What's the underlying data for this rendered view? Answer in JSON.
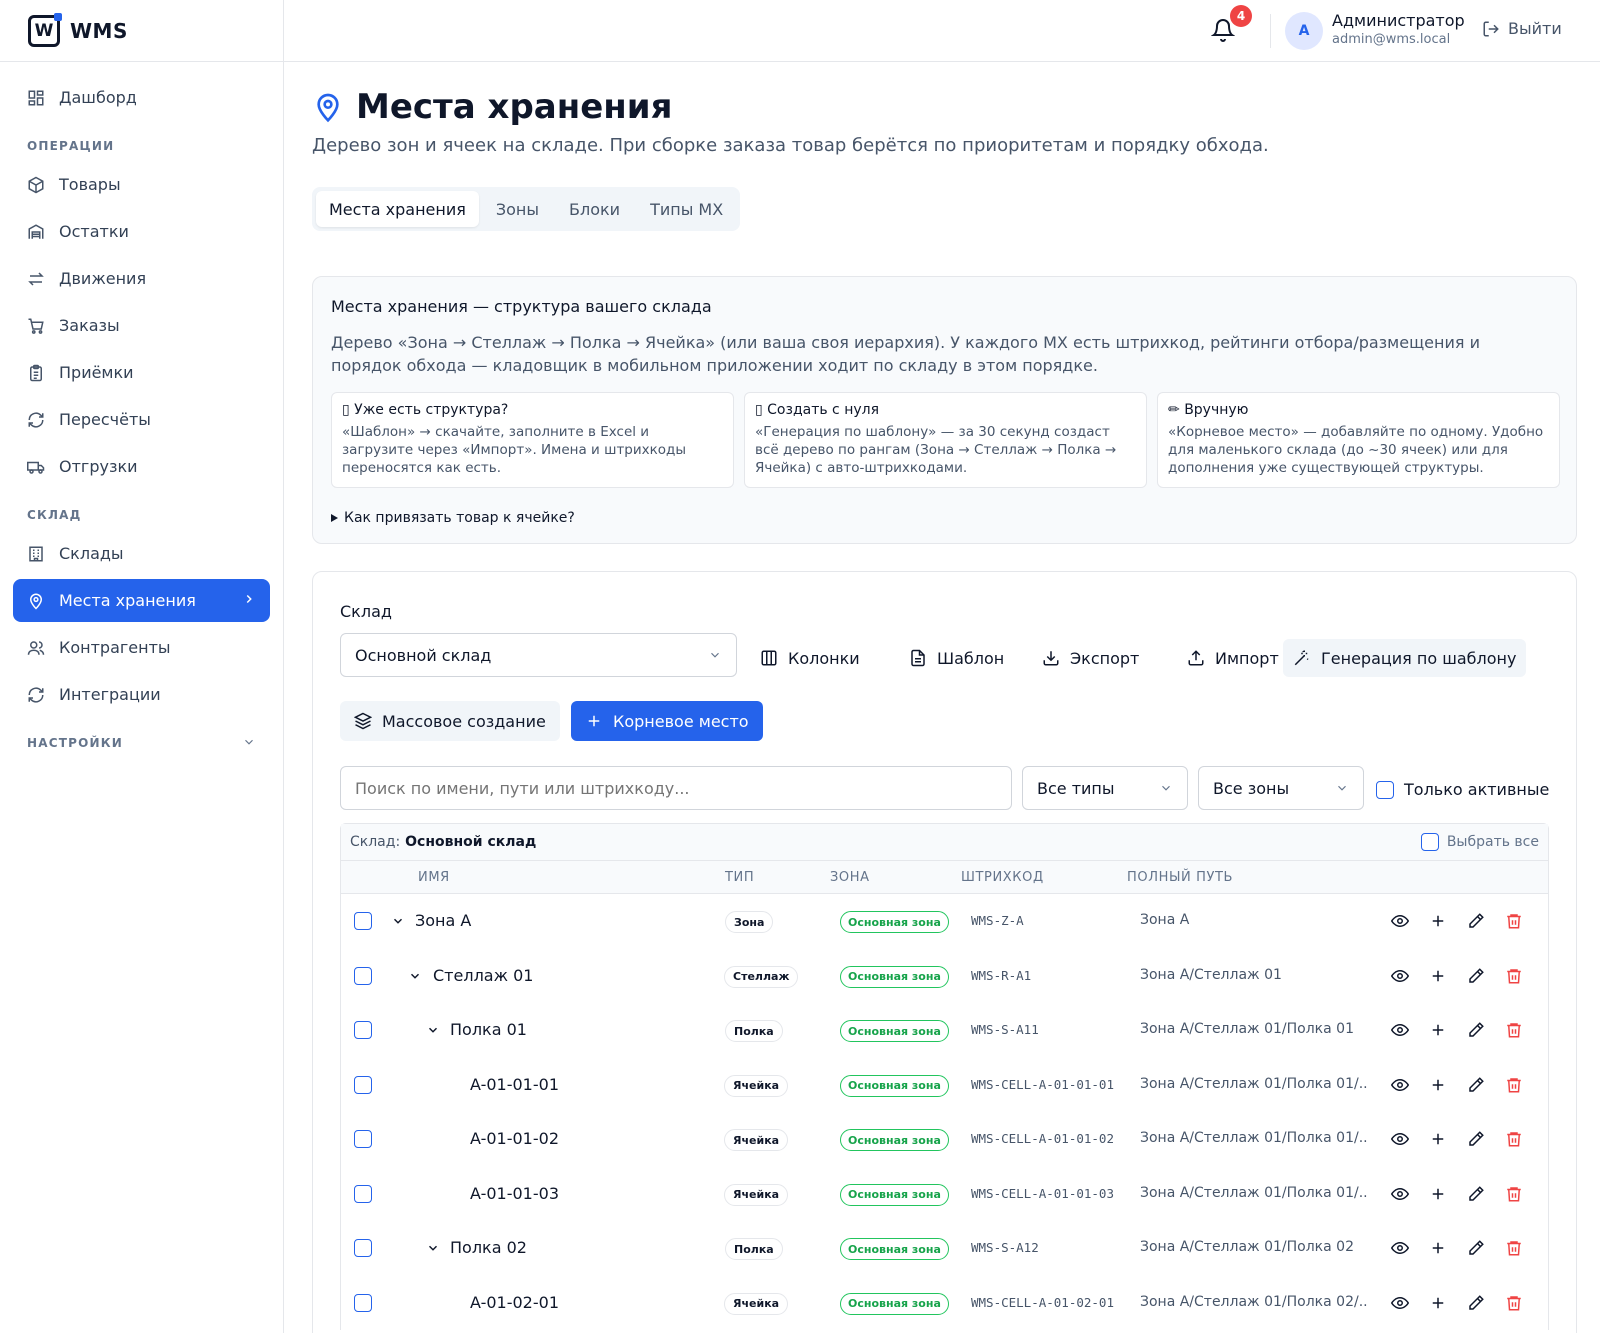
{
  "app": {
    "name": "WMS",
    "logo_letter": "W"
  },
  "sidebar": {
    "top_item": {
      "label": "Дашборд",
      "icon": "dashboard-icon"
    },
    "sections": [
      {
        "label": "ОПЕРАЦИИ",
        "items": [
          {
            "label": "Товары",
            "icon": "package-icon"
          },
          {
            "label": "Остатки",
            "icon": "stock-icon"
          },
          {
            "label": "Движения",
            "icon": "arrows-icon"
          },
          {
            "label": "Заказы",
            "icon": "cart-icon"
          },
          {
            "label": "Приёмки",
            "icon": "clipboard-icon"
          },
          {
            "label": "Пересчёты",
            "icon": "refresh-icon"
          },
          {
            "label": "Отгрузки",
            "icon": "truck-icon"
          }
        ]
      },
      {
        "label": "СКЛАД",
        "items": [
          {
            "label": "Склады",
            "icon": "building-icon"
          },
          {
            "label": "Места хранения",
            "icon": "map-pin-icon",
            "active": true
          },
          {
            "label": "Контрагенты",
            "icon": "users-icon"
          },
          {
            "label": "Интеграции",
            "icon": "sync-icon"
          }
        ]
      },
      {
        "label": "НАСТРОЙКИ",
        "collapsed": true
      }
    ]
  },
  "topbar": {
    "notifications_count": "4",
    "user": {
      "initial": "A",
      "name": "Администратор",
      "email": "admin@wms.local"
    },
    "logout_label": "Выйти"
  },
  "page": {
    "title": "Места хранения",
    "subtitle": "Дерево зон и ячеек на складе. При сборке заказа товар берётся по приоритетам и порядку обхода.",
    "tabs": [
      {
        "label": "Места хранения",
        "active": true
      },
      {
        "label": "Зоны"
      },
      {
        "label": "Блоки"
      },
      {
        "label": "Типы МХ"
      }
    ]
  },
  "info": {
    "title": "Места хранения — структура вашего склада",
    "text": "Дерево «Зона → Стеллаж → Полка → Ячейка» (или ваша своя иерархия). У каждого МХ есть штрихкод, рейтинги отбора/размещения и порядок обхода — кладовщик в мобильном приложении ходит по складу в этом порядке.",
    "cards": [
      {
        "title": "Уже есть структура?",
        "text": "«Шаблон» → скачайте, заполните в Excel и загрузите через «Импорт». Имена и штрихкоды переносятся как есть."
      },
      {
        "title": "Создать с нуля",
        "text": "«Генерация по шаблону» — за 30 секунд создаст всё дерево по рангам (Зона → Стеллаж → Полка → Ячейка) с авто-штрихкодами."
      },
      {
        "title": "Вручную",
        "text": "«Корневое место» — добавляйте по одному. Удобно для маленького склада (до ~30 ячеек) или для дополнения уже существующей структуры."
      }
    ],
    "details_label": "Как привязать товар к ячейке?"
  },
  "toolbar": {
    "warehouse_label": "Склад",
    "warehouse_value": "Основной склад",
    "columns": "Колонки",
    "template": "Шаблон",
    "export": "Экспорт",
    "import": "Импорт",
    "generate": "Генерация по шаблону",
    "bulk_create": "Массовое создание",
    "root_place": "Корневое место"
  },
  "filters": {
    "search_placeholder": "Поиск по имени, пути или штрихкоду...",
    "type_value": "Все типы",
    "zone_value": "Все зоны",
    "only_active": "Только активные"
  },
  "table": {
    "warehouse_prefix": "Склад:",
    "warehouse_name": "Основной склад",
    "select_all": "Выбрать все",
    "headers": {
      "name": "ИМЯ",
      "type": "ТИП",
      "zone": "ЗОНА",
      "barcode": "ШТРИХКОД",
      "path": "ПОЛНЫЙ ПУТЬ"
    },
    "rows": [
      {
        "name": "Зона А",
        "type": "Зона",
        "zone": "Основная зона",
        "barcode": "WMS-Z-A",
        "path": "Зона А",
        "level": 0,
        "expandable": true
      },
      {
        "name": "Стеллаж 01",
        "type": "Стеллаж",
        "zone": "Основная зона",
        "barcode": "WMS-R-A1",
        "path": "Зона А/Стеллаж 01",
        "level": 1,
        "expandable": true
      },
      {
        "name": "Полка 01",
        "type": "Полка",
        "zone": "Основная зона",
        "barcode": "WMS-S-A11",
        "path": "Зона А/Стеллаж 01/Полка 01",
        "level": 2,
        "expandable": true
      },
      {
        "name": "A-01-01-01",
        "type": "Ячейка",
        "zone": "Основная зона",
        "barcode": "WMS-CELL-A-01-01-01",
        "path": "Зона А/Стеллаж 01/Полка 01/...",
        "level": 3,
        "expandable": false
      },
      {
        "name": "A-01-01-02",
        "type": "Ячейка",
        "zone": "Основная зона",
        "barcode": "WMS-CELL-A-01-01-02",
        "path": "Зона А/Стеллаж 01/Полка 01/...",
        "level": 3,
        "expandable": false
      },
      {
        "name": "A-01-01-03",
        "type": "Ячейка",
        "zone": "Основная зона",
        "barcode": "WMS-CELL-A-01-01-03",
        "path": "Зона А/Стеллаж 01/Полка 01/...",
        "level": 3,
        "expandable": false
      },
      {
        "name": "Полка 02",
        "type": "Полка",
        "zone": "Основная зона",
        "barcode": "WMS-S-A12",
        "path": "Зона А/Стеллаж 01/Полка 02",
        "level": 2,
        "expandable": true
      },
      {
        "name": "A-01-02-01",
        "type": "Ячейка",
        "zone": "Основная зона",
        "barcode": "WMS-CELL-A-01-02-01",
        "path": "Зона А/Стеллаж 01/Полка 02/...",
        "level": 3,
        "expandable": false
      }
    ]
  },
  "colors": {
    "accent": "#2563eb",
    "danger": "#ef4444",
    "success": "#16a34a"
  }
}
